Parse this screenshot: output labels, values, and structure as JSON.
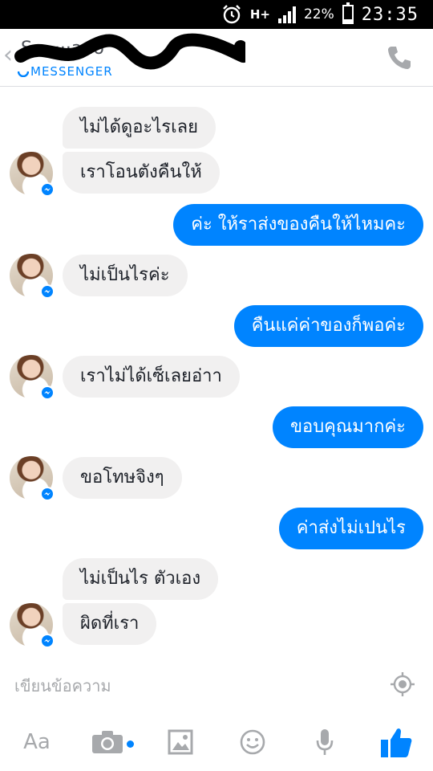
{
  "status_bar": {
    "network": "H+",
    "battery_percent": "22%",
    "battery_level": 0.22,
    "time": "23:35"
  },
  "header": {
    "contact_name": "S··· ···ado",
    "subtitle": "MESSENGER",
    "back_icon": "chevron-left-icon",
    "call_icon": "phone-icon"
  },
  "messages": [
    {
      "direction": "in",
      "text": "ไม่ได้ดูอะไรเลย"
    },
    {
      "direction": "in",
      "text": "เราโอนตังคืนให้"
    },
    {
      "direction": "out",
      "text": "ค่ะ ให้ราส่งของคืนให้ไหมคะ"
    },
    {
      "direction": "in",
      "text": "ไม่เป็นไรค่ะ"
    },
    {
      "direction": "out",
      "text": "คืนแค่ค่าของก็พอค่ะ"
    },
    {
      "direction": "in",
      "text": "เราไม่ได้เซ็เลยอ่าา"
    },
    {
      "direction": "out",
      "text": "ขอบคุณมากค่ะ"
    },
    {
      "direction": "in",
      "text": "ขอโทษจิงๆ"
    },
    {
      "direction": "out",
      "text": "ค่าส่งไม่เปนไร"
    },
    {
      "direction": "in",
      "text": "ไม่เป็นไร ตัวเอง"
    },
    {
      "direction": "in",
      "text": "ผิดที่เรา"
    }
  ],
  "composer": {
    "placeholder": "เขียนข้อความ",
    "value": ""
  },
  "toolbar": {
    "text_format_label": "Aa",
    "icons": [
      "text-format-icon",
      "camera-icon",
      "image-icon",
      "emoji-icon",
      "microphone-icon",
      "like-icon"
    ]
  },
  "colors": {
    "accent": "#0084ff",
    "incoming_bubble": "#f1f0f0",
    "icon_gray": "#a7a9ac"
  }
}
